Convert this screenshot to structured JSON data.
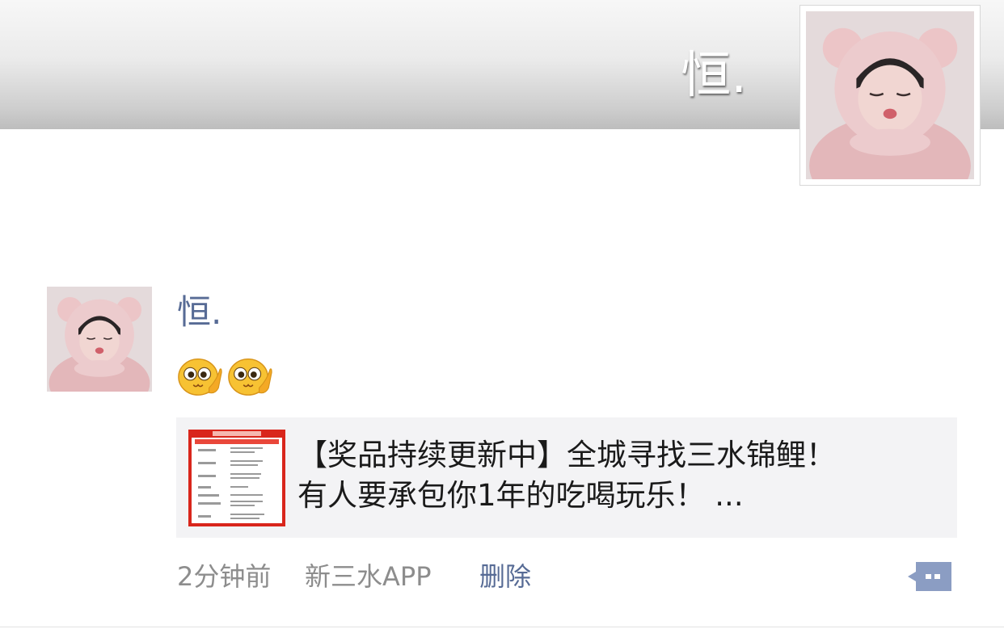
{
  "profile": {
    "cover_name": "恒.",
    "avatar": "girl-bear-hood-photo"
  },
  "post": {
    "author": "恒.",
    "emojis": [
      "hand-on-cheek-emoji",
      "hand-on-cheek-emoji"
    ],
    "link": {
      "title_line1": "【奖品持续更新中】全城寻找三水锦鲤！",
      "title_line2": "有人要承包你1年的吃喝玩乐！ ...",
      "thumbnail": "red-prize-list-poster"
    },
    "meta": {
      "time": "2分钟前",
      "source": "新三水APP",
      "delete_label": "删除"
    },
    "actions": {
      "comment_icon": "comment-more-icon"
    }
  },
  "colors": {
    "name_blue": "#576b95",
    "meta_gray": "#8d8d8d",
    "card_bg": "#f3f3f5"
  }
}
